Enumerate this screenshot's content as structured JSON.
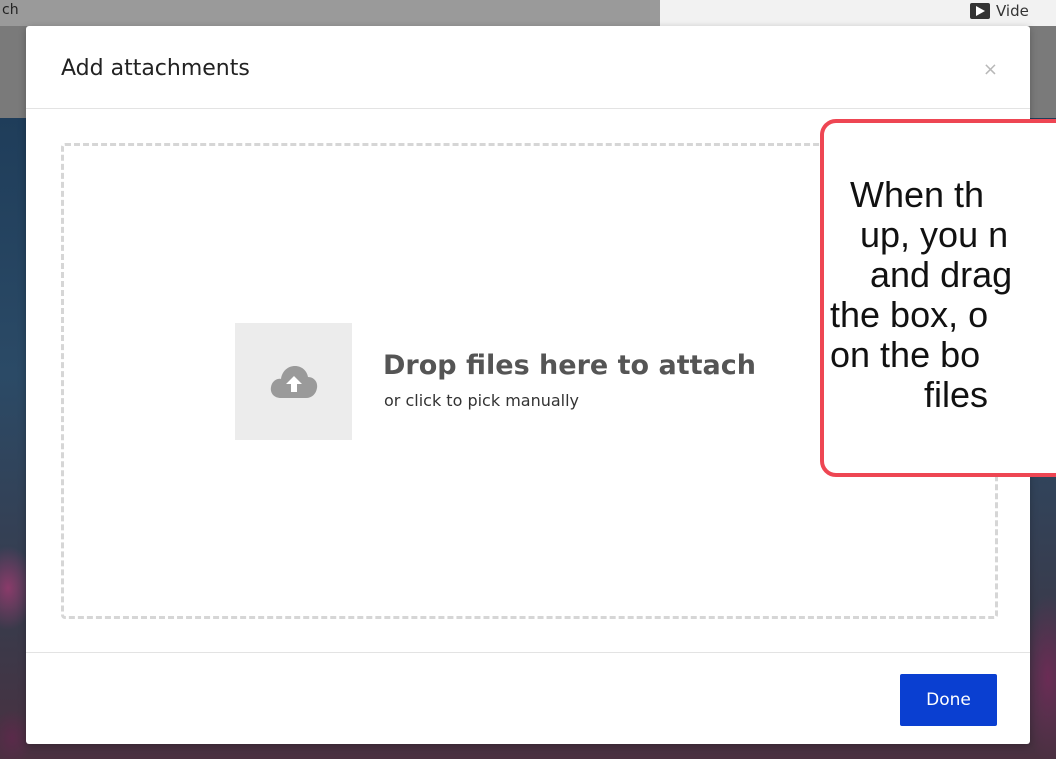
{
  "background": {
    "crumb": "ch",
    "video_label": "Vide"
  },
  "modal": {
    "title": "Add attachments",
    "close_symbol": "×",
    "dropzone": {
      "title": "Drop files here to attach",
      "subtitle": "or click to pick manually",
      "icon": "cloud-upload-icon"
    },
    "done_label": "Done"
  },
  "callout": {
    "lines": [
      "When th",
      "up, you n",
      "and drag",
      "the box, o",
      "on the bo",
      "files"
    ]
  },
  "colors": {
    "primary_button": "#0a3fd1",
    "callout_border": "#ee4653",
    "dropzone_border": "#d6d6d6"
  }
}
